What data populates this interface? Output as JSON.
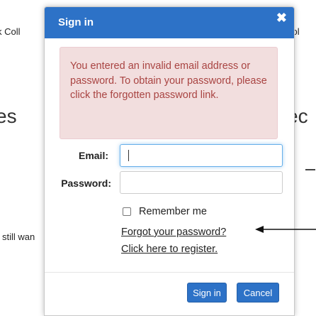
{
  "background": {
    "left_top_text": "k Coll",
    "right_top_text": "hool",
    "left_heading": "es",
    "right_heading": "ec",
    "left_mid_text": "still wan"
  },
  "dialog": {
    "title": "Sign in",
    "close_symbol": "✖",
    "alert_message": "You entered an invalid email address or password. To obtain your password, please click the forgotten password link.",
    "email_label": "Email:",
    "email_value": "",
    "password_label": "Password:",
    "password_value": "",
    "remember_label": "Remember me",
    "remember_checked": false,
    "forgot_link": "Forgot your password?",
    "register_link": "Click here to register.",
    "signin_button": "Sign in",
    "cancel_button": "Cancel"
  },
  "colors": {
    "header_bg": "#2d72c7",
    "alert_bg": "#f2dede",
    "alert_text": "#a94442",
    "button_bg": "#2d72c7"
  },
  "icons": {
    "close": "close-icon",
    "annotation": "arrow-left-icon"
  }
}
